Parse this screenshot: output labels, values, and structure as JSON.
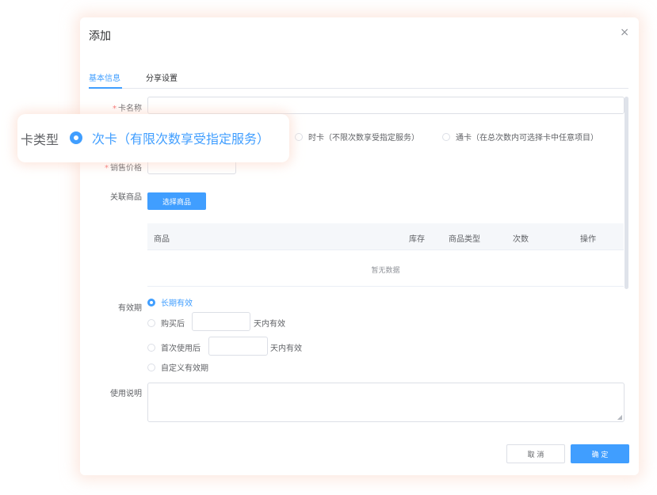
{
  "dialog": {
    "title": "添加",
    "close_symbol": "×",
    "tabs": [
      {
        "label": "基本信息",
        "active": true
      },
      {
        "label": "分享设置",
        "active": false
      }
    ]
  },
  "form": {
    "card_name": {
      "required_mark": "*",
      "label": "卡名称",
      "value": ""
    },
    "card_type": {
      "options": [
        {
          "label": "时卡（不限次数享受指定服务）",
          "checked": false
        },
        {
          "label": "通卡（在总次数内可选择卡中任意项目）",
          "checked": false
        }
      ]
    },
    "sale_price": {
      "required_mark": "*",
      "label": "销售价格",
      "value": ""
    },
    "related_products": {
      "label": "关联商品",
      "select_button": "选择商品",
      "table": {
        "columns": [
          "商品",
          "库存",
          "商品类型",
          "次数",
          "操作"
        ],
        "empty_text": "暂无数据"
      }
    },
    "validity": {
      "label": "有效期",
      "options": [
        {
          "label": "长期有效",
          "checked": true
        },
        {
          "label": "购买后",
          "checked": false,
          "suffix": "天内有效",
          "value": ""
        },
        {
          "label": "首次使用后",
          "checked": false,
          "suffix": "天内有效",
          "value": ""
        },
        {
          "label": "自定义有效期",
          "checked": false
        }
      ]
    },
    "usage_notes": {
      "label": "使用说明",
      "value": ""
    }
  },
  "footer": {
    "cancel": "取 消",
    "confirm": "确 定"
  },
  "zoom_callout": {
    "label": "卡类型",
    "selected_option": "次卡（有限次数享受指定服务）"
  },
  "colors": {
    "accent": "#409eff",
    "required": "#f56c6c",
    "callout_glow": "#fad7c8"
  },
  "icons": {
    "close": "close-icon",
    "resize": "resize-handle-icon"
  }
}
